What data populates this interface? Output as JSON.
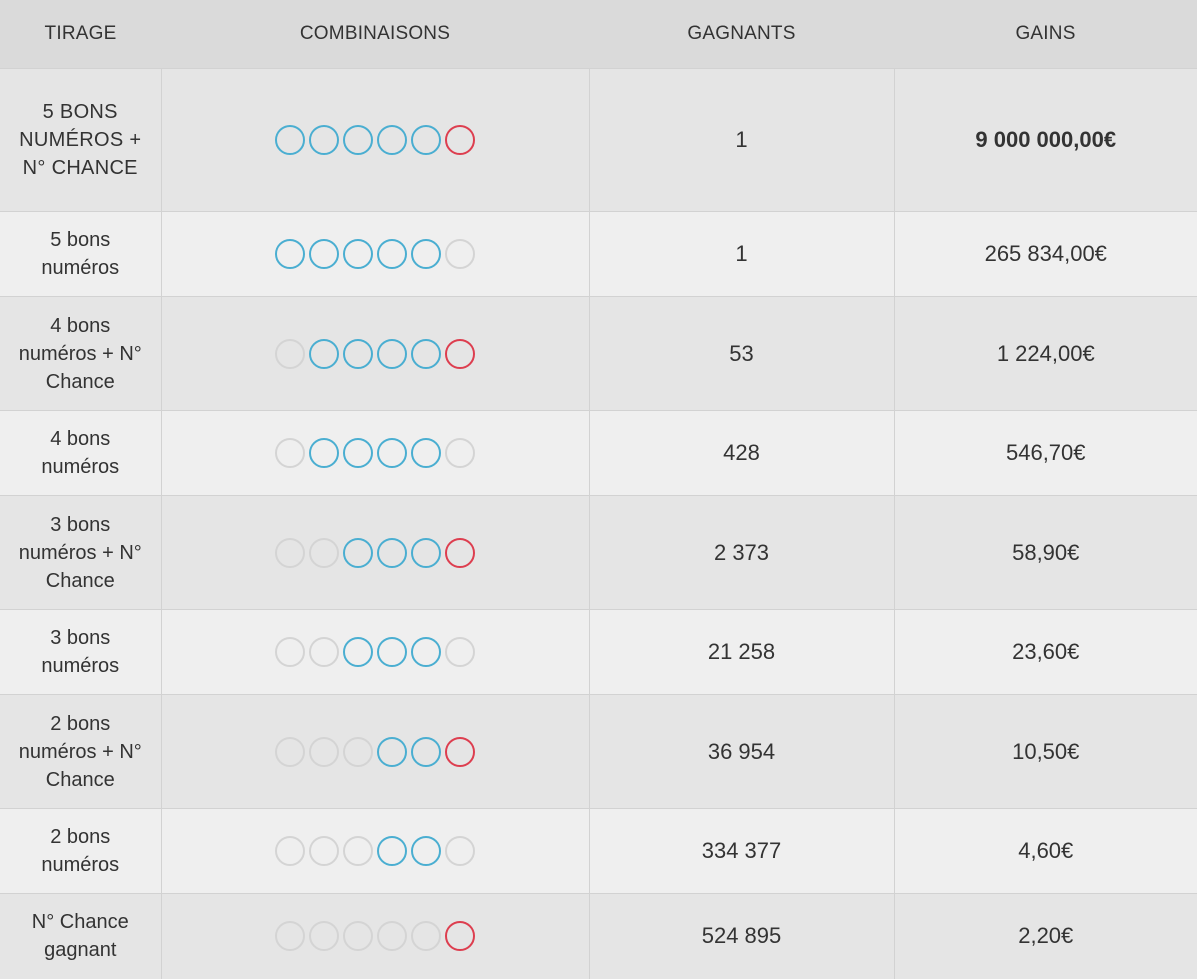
{
  "headers": {
    "tirage": "TIRAGE",
    "combinaisons": "COMBINAISONS",
    "gagnants": "GAGNANTS",
    "gains": "GAINS"
  },
  "colors": {
    "ball_match": "#4aaed1",
    "ball_chance": "#dd3e4f",
    "ball_empty": "#d4d4d4"
  },
  "rows": [
    {
      "tirage": "5 BONS NUMÉROS + N° CHANCE",
      "balls": [
        "win",
        "win",
        "win",
        "win",
        "win",
        "chance"
      ],
      "gagnants": "1",
      "gains": "9 000 000,00€"
    },
    {
      "tirage": "5 bons numéros",
      "balls": [
        "win",
        "win",
        "win",
        "win",
        "win",
        "empty"
      ],
      "gagnants": "1",
      "gains": "265 834,00€"
    },
    {
      "tirage": "4 bons numéros + N° Chance",
      "balls": [
        "empty",
        "win",
        "win",
        "win",
        "win",
        "chance"
      ],
      "gagnants": "53",
      "gains": "1 224,00€"
    },
    {
      "tirage": "4 bons numéros",
      "balls": [
        "empty",
        "win",
        "win",
        "win",
        "win",
        "empty"
      ],
      "gagnants": "428",
      "gains": "546,70€"
    },
    {
      "tirage": "3 bons numéros + N° Chance",
      "balls": [
        "empty",
        "empty",
        "win",
        "win",
        "win",
        "chance"
      ],
      "gagnants": "2 373",
      "gains": "58,90€"
    },
    {
      "tirage": "3 bons numéros",
      "balls": [
        "empty",
        "empty",
        "win",
        "win",
        "win",
        "empty"
      ],
      "gagnants": "21 258",
      "gains": "23,60€"
    },
    {
      "tirage": "2 bons numéros + N° Chance",
      "balls": [
        "empty",
        "empty",
        "empty",
        "win",
        "win",
        "chance"
      ],
      "gagnants": "36 954",
      "gains": "10,50€"
    },
    {
      "tirage": "2 bons numéros",
      "balls": [
        "empty",
        "empty",
        "empty",
        "win",
        "win",
        "empty"
      ],
      "gagnants": "334 377",
      "gains": "4,60€"
    },
    {
      "tirage": "N° Chance gagnant",
      "balls": [
        "empty",
        "empty",
        "empty",
        "empty",
        "empty",
        "chance"
      ],
      "gagnants": "524 895",
      "gains": "2,20€"
    }
  ]
}
